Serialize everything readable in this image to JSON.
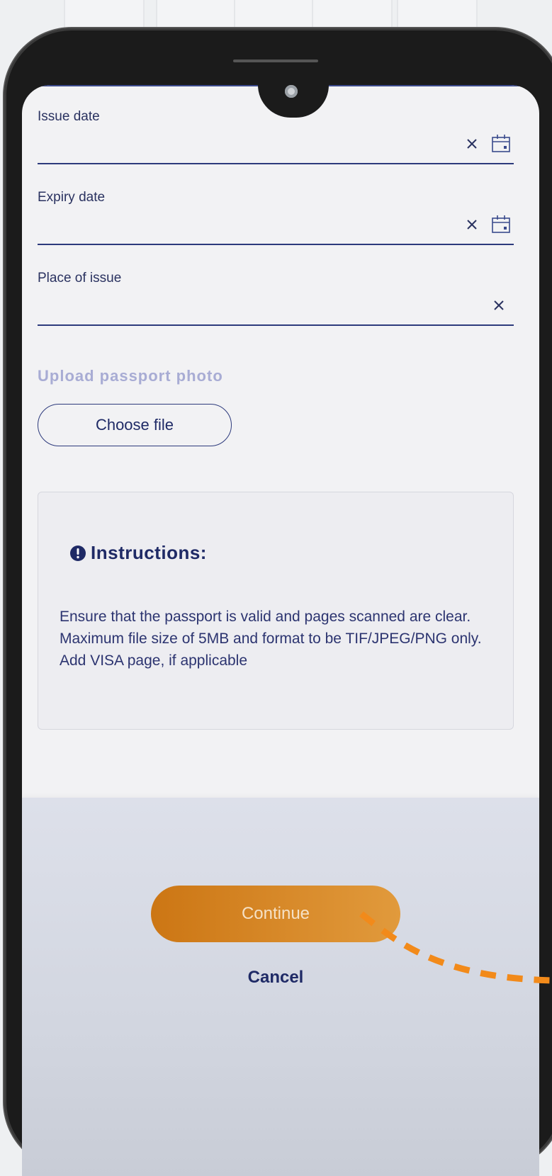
{
  "form": {
    "issue_date": {
      "label": "Issue date",
      "value": ""
    },
    "expiry_date": {
      "label": "Expiry date",
      "value": ""
    },
    "place_of_issue": {
      "label": "Place of issue",
      "value": ""
    }
  },
  "upload": {
    "title": "Upload passport photo",
    "choose_label": "Choose file"
  },
  "instructions": {
    "title": "Instructions:",
    "text": "Ensure that the passport is valid and pages scanned are clear. Maximum file size of 5MB and format to be TIF/JPEG/PNG only. Add VISA page, if applicable"
  },
  "actions": {
    "continue_label": "Continue",
    "cancel_label": "Cancel"
  },
  "colors": {
    "accent": "#2d3a7c",
    "primary_button": "#d9892a",
    "annotation": "#f28a1a"
  },
  "icons": {
    "clear": "close-icon",
    "calendar": "calendar-icon",
    "info": "info-icon"
  }
}
